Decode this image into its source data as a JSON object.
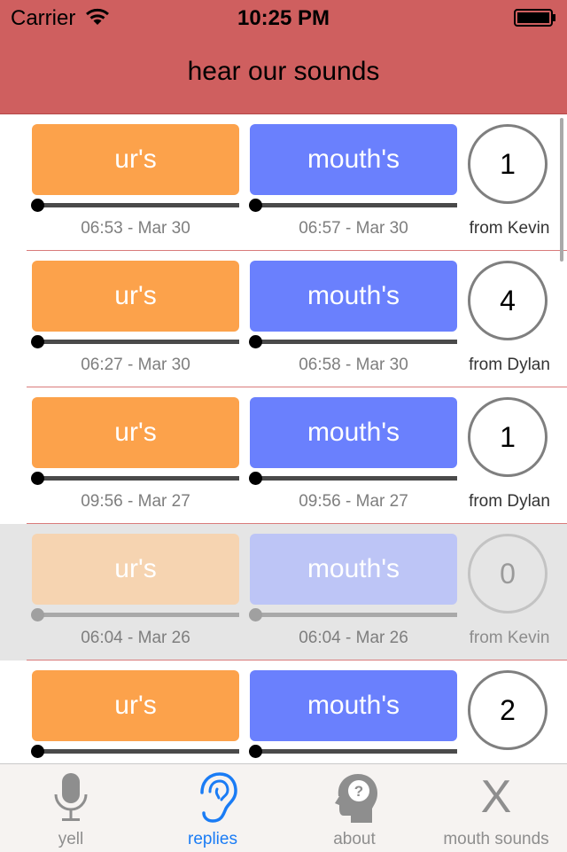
{
  "status_bar": {
    "carrier": "Carrier",
    "time": "10:25 PM"
  },
  "header": {
    "title": "hear our sounds"
  },
  "rows": [
    {
      "ur_label": "ur's",
      "mouth_label": "mouth's",
      "ur_time": "06:53 - Mar 30",
      "mouth_time": "06:57 - Mar 30",
      "count": "1",
      "from": "from Kevin",
      "enabled": true
    },
    {
      "ur_label": "ur's",
      "mouth_label": "mouth's",
      "ur_time": "06:27 - Mar 30",
      "mouth_time": "06:58 - Mar 30",
      "count": "4",
      "from": "from Dylan",
      "enabled": true
    },
    {
      "ur_label": "ur's",
      "mouth_label": "mouth's",
      "ur_time": "09:56 - Mar 27",
      "mouth_time": "09:56 - Mar 27",
      "count": "1",
      "from": "from Dylan",
      "enabled": true
    },
    {
      "ur_label": "ur's",
      "mouth_label": "mouth's",
      "ur_time": "06:04 - Mar 26",
      "mouth_time": "06:04 - Mar 26",
      "count": "0",
      "from": "from Kevin",
      "enabled": false
    },
    {
      "ur_label": "ur's",
      "mouth_label": "mouth's",
      "ur_time": "",
      "mouth_time": "",
      "count": "2",
      "from": "",
      "enabled": true
    }
  ],
  "tabs": [
    {
      "label": "yell",
      "icon": "microphone-icon",
      "active": false
    },
    {
      "label": "replies",
      "icon": "ear-icon",
      "active": true
    },
    {
      "label": "about",
      "icon": "head-question-icon",
      "active": false
    },
    {
      "label": "mouth sounds",
      "icon": "x-icon",
      "active": false
    }
  ],
  "colors": {
    "header_bg": "#cf5f5f",
    "ur_button": "#fca24b",
    "mouth_button": "#6a80fd",
    "active_tab": "#1a7cf5",
    "inactive_tab": "#8e8e8e"
  }
}
